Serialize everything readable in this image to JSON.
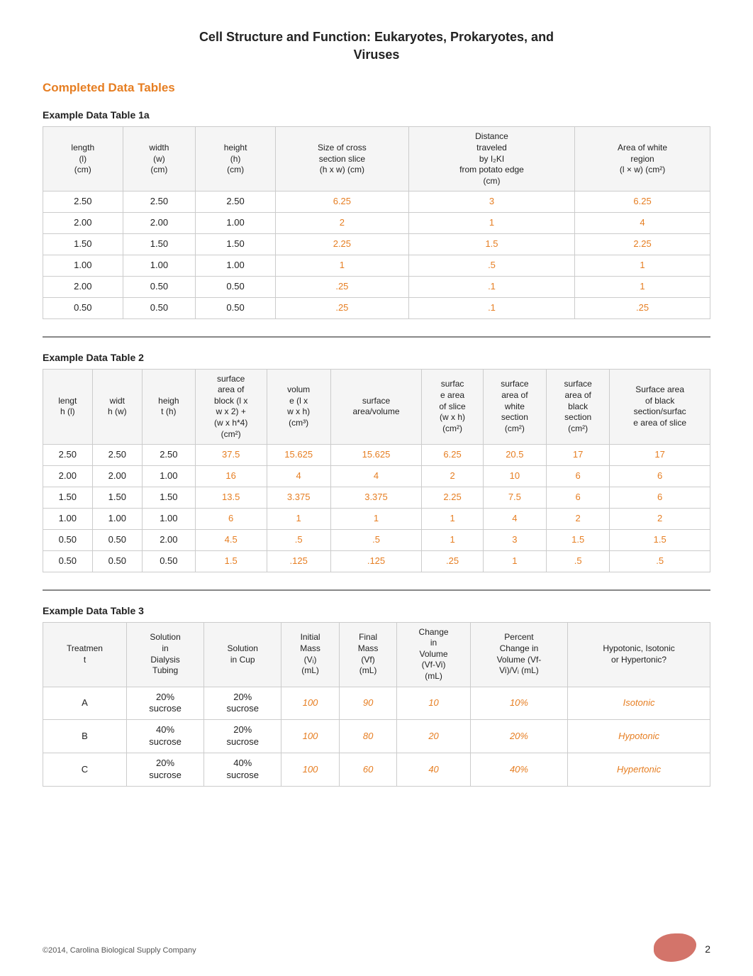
{
  "page": {
    "title_line1": "Cell Structure and Function: Eukaryotes, Prokaryotes, and",
    "title_line2": "Viruses",
    "section_title": "Completed Data Tables",
    "table1a_label": "Example Data Table 1a",
    "table2_label": "Example Data Table 2",
    "table3_label": "Example Data Table 3",
    "footer_text": "©2014, Carolina Biological Supply\nCompany",
    "page_number": "2"
  },
  "table1a": {
    "headers": [
      "length\n(l)\n(cm)",
      "width\n(w)\n(cm)",
      "height\n(h)\n(cm)",
      "Size of cross\nsection slice\n(h x w) (cm)",
      "Distance\ntraveled\nby I₂KI\nfrom potato edge\n(cm)",
      "Area of white\nregion\n(l × w) (cm²)"
    ],
    "rows": [
      [
        "2.50",
        "2.50",
        "2.50",
        "6.25",
        "3",
        "6.25"
      ],
      [
        "2.00",
        "2.00",
        "1.00",
        "2",
        "1",
        "4"
      ],
      [
        "1.50",
        "1.50",
        "1.50",
        "2.25",
        "1.5",
        "2.25"
      ],
      [
        "1.00",
        "1.00",
        "1.00",
        "1",
        ".5",
        "1"
      ],
      [
        "2.00",
        "0.50",
        "0.50",
        ".25",
        ".1",
        "1"
      ],
      [
        "0.50",
        "0.50",
        "0.50",
        ".25",
        ".1",
        ".25"
      ]
    ],
    "orange_cols": [
      3,
      4,
      5
    ]
  },
  "table2": {
    "headers": [
      "lengt\nh (l)",
      "widt\nh (w)",
      "heigh\nt (h)",
      "surface\narea of\nblock (l x\nw x 2) +\n(w x h*4)\n(cm²)",
      "volum\ne (l x\nw x h)\n(cm³)",
      "surface\narea/volume",
      "surfac\ne area\nof slice\n(w x h)\n(cm²)",
      "surface\narea of\nwhite\nsection\n(cm²)",
      "surface\narea of\nblack\nsection\n(cm²)",
      "Surface area\nof black\nsection/surfac\ne area of slice"
    ],
    "rows": [
      [
        "2.50",
        "2.50",
        "2.50",
        "37.5",
        "15.625",
        "15.625",
        "6.25",
        "20.5",
        "17",
        "17"
      ],
      [
        "2.00",
        "2.00",
        "1.00",
        "16",
        "4",
        "4",
        "2",
        "10",
        "6",
        "6"
      ],
      [
        "1.50",
        "1.50",
        "1.50",
        "13.5",
        "3.375",
        "3.375",
        "2.25",
        "7.5",
        "6",
        "6"
      ],
      [
        "1.00",
        "1.00",
        "1.00",
        "6",
        "1",
        "1",
        "1",
        "4",
        "2",
        "2"
      ],
      [
        "0.50",
        "0.50",
        "2.00",
        "4.5",
        ".5",
        ".5",
        "1",
        "3",
        "1.5",
        "1.5"
      ],
      [
        "0.50",
        "0.50",
        "0.50",
        "1.5",
        ".125",
        ".125",
        ".25",
        "1",
        ".5",
        ".5"
      ]
    ],
    "orange_cols": [
      3,
      4,
      5,
      6,
      7,
      8,
      9
    ]
  },
  "table3": {
    "headers": [
      "Treatmen\nt",
      "Solution\nin\nDialysis\nTubing",
      "Solution\nin Cup",
      "Initial\nMass\n(Vᵢ)\n(mL)",
      "Final\nMass\n(Vf)\n(mL)",
      "Change\nin\nVolume\n(Vf-Vi)\n(mL)",
      "Percent\nChange in\nVolume (Vf-\nVi)/Vᵢ (mL)",
      "Hypotonic, Isotonic\nor Hypertonic?"
    ],
    "rows": [
      {
        "treatment": "A",
        "dialysis": "20%\nsucrose",
        "cup": "20%\nsucrose",
        "vi": "100",
        "vf": "90",
        "change": "10",
        "percent": "10%",
        "result": "Isotonic"
      },
      {
        "treatment": "B",
        "dialysis": "40%\nsucrose",
        "cup": "20%\nsucrose",
        "vi": "100",
        "vf": "80",
        "change": "20",
        "percent": "20%",
        "result": "Hypotonic"
      },
      {
        "treatment": "C",
        "dialysis": "20%\nsucrose",
        "cup": "40%\nsucrose",
        "vi": "100",
        "vf": "60",
        "change": "40",
        "percent": "40%",
        "result": "Hypertonic"
      }
    ]
  }
}
